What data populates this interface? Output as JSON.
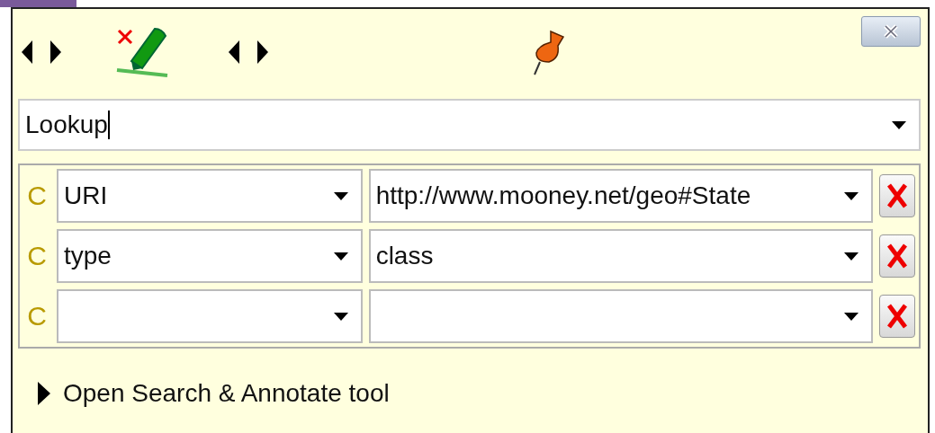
{
  "lookup": {
    "value": "Lookup",
    "focused": true
  },
  "conditions": [
    {
      "marker": "C",
      "property": "URI",
      "value": "http://www.mooney.net/geo#State"
    },
    {
      "marker": "C",
      "property": "type",
      "value": "class"
    },
    {
      "marker": "C"
    }
  ],
  "expander": {
    "label": "Open Search & Annotate tool",
    "expanded": false
  }
}
